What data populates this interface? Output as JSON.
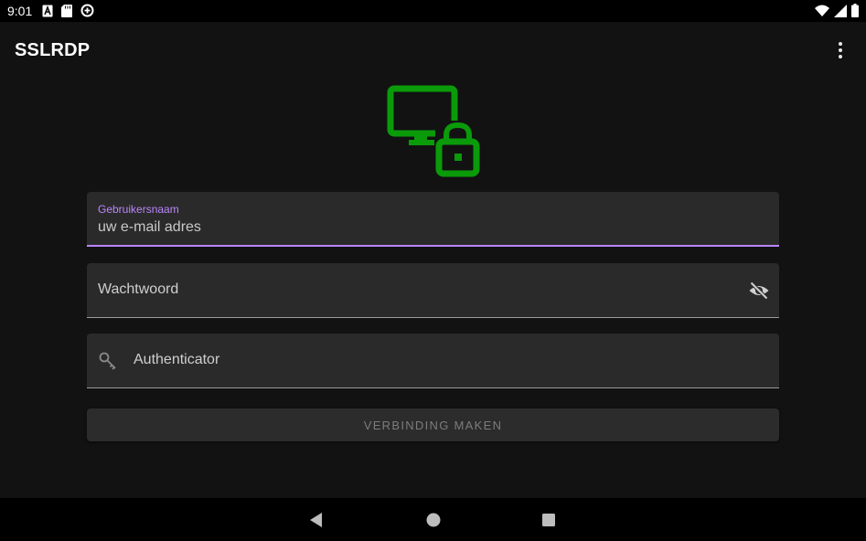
{
  "status_bar": {
    "time": "9:01",
    "left_icons": [
      "font-a-icon",
      "sd-card-icon",
      "data-saver-icon"
    ],
    "right_icons": [
      "wifi-icon",
      "cell-signal-icon",
      "battery-icon"
    ]
  },
  "toolbar": {
    "title": "SSLRDP",
    "overflow_icon": "more-vert-icon"
  },
  "logo": {
    "icon": "monitor-lock-icon",
    "color": "#0a9a0a"
  },
  "form": {
    "username": {
      "label": "Gebruikersnaam",
      "placeholder": "uw e-mail adres"
    },
    "password": {
      "label": "Wachtwoord",
      "toggle_icon": "visibility-off-icon"
    },
    "authenticator": {
      "label": "Authenticator",
      "icon": "key-icon"
    },
    "connect_button": {
      "label": "VERBINDING MAKEN"
    }
  },
  "navigation_bar": {
    "buttons": [
      "back-icon",
      "home-icon",
      "recents-icon"
    ]
  },
  "colors": {
    "accent": "#bb86fc",
    "logo_green": "#0a9a0a",
    "background": "#121212",
    "field_background": "#2a2a2a"
  }
}
